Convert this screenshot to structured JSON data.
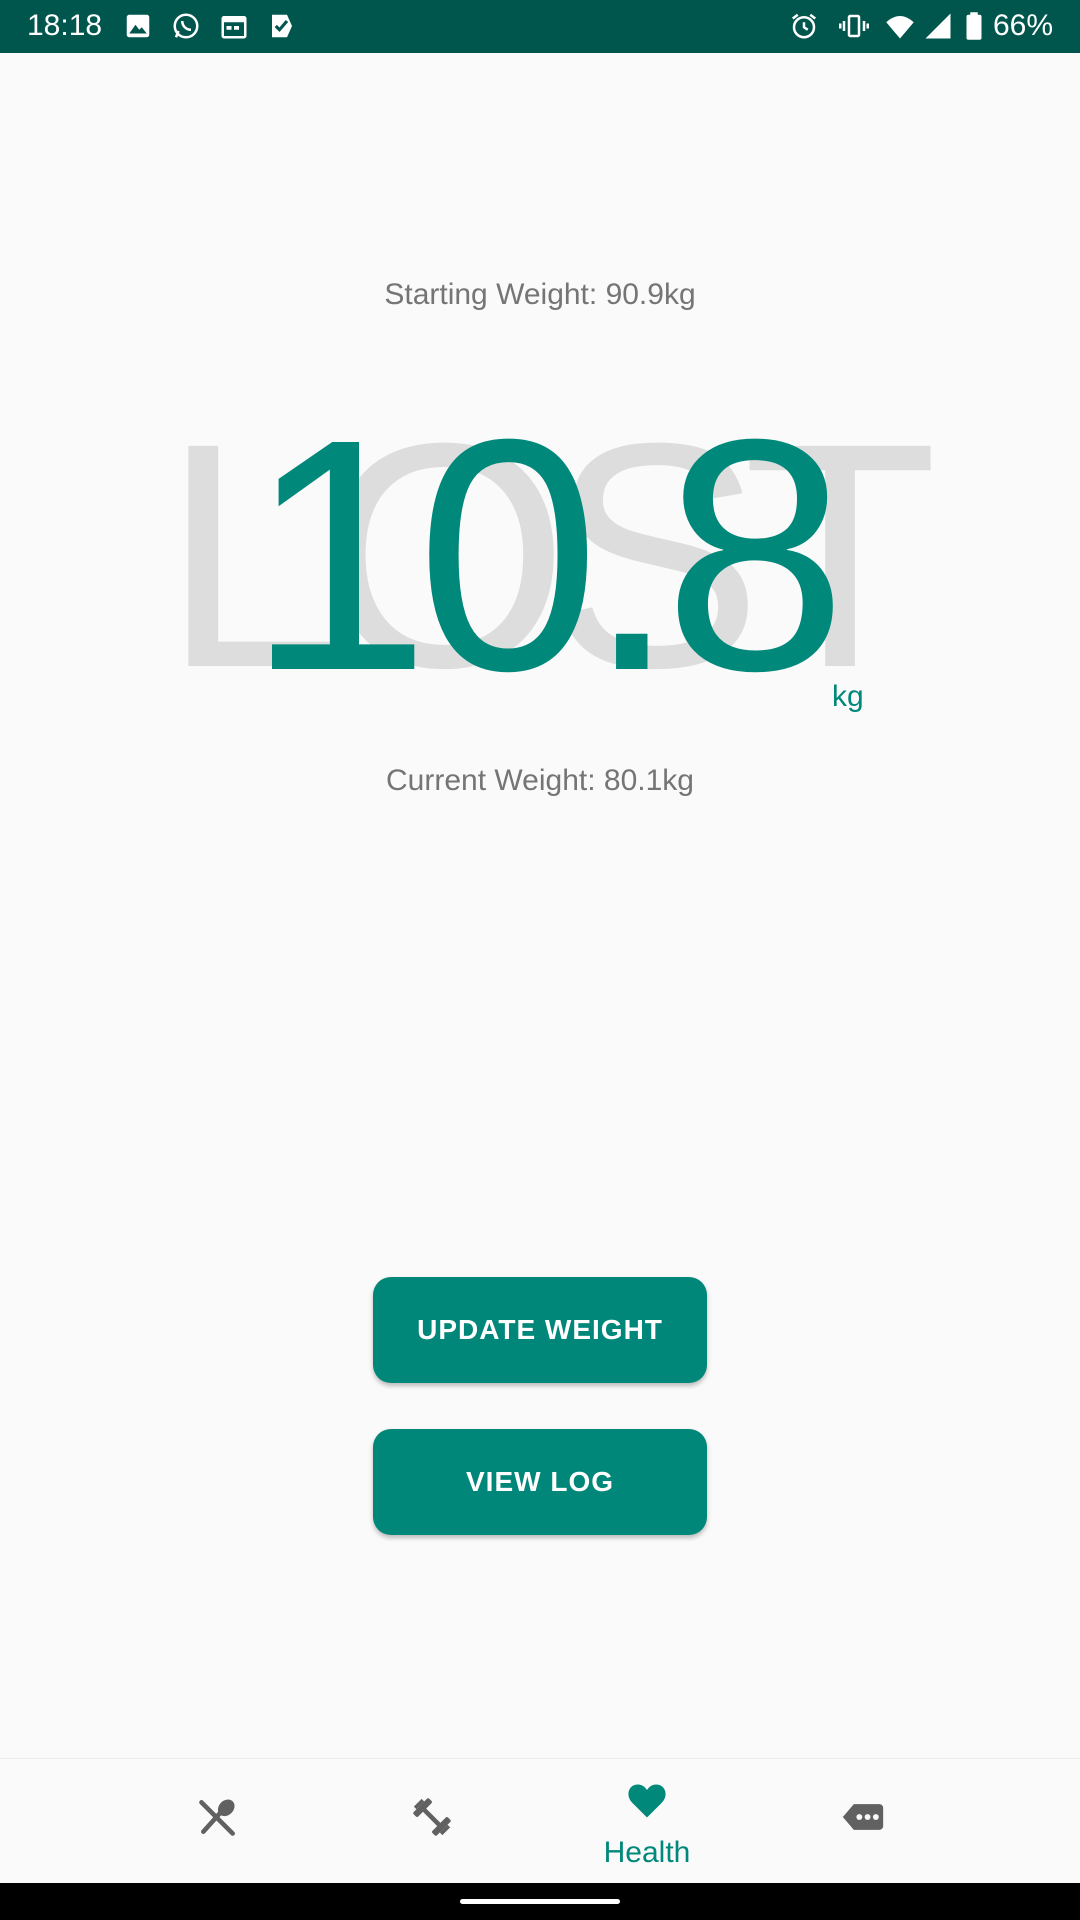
{
  "status_bar": {
    "time": "18:18",
    "battery_percent": "66%",
    "background_color": "#00564d",
    "icons": [
      "image-icon",
      "whatsapp-icon",
      "calendar-icon",
      "task-icon",
      "alarm-icon",
      "vibrate-icon",
      "wifi-icon",
      "signal-icon",
      "battery-icon"
    ]
  },
  "weight": {
    "starting_label": "Starting Weight: 90.9kg",
    "watermark": "LOST",
    "lost_value": "10.8",
    "unit": "kg",
    "current_label": "Current Weight: 80.1kg"
  },
  "buttons": {
    "update_weight": "UPDATE WEIGHT",
    "view_log": "VIEW LOG"
  },
  "bottom_nav": {
    "items": [
      {
        "icon": "food-utensils-icon",
        "label": ""
      },
      {
        "icon": "dumbbell-icon",
        "label": ""
      },
      {
        "icon": "heart-icon",
        "label": "Health",
        "active": true
      },
      {
        "icon": "more-tag-icon",
        "label": ""
      }
    ]
  },
  "colors": {
    "accent": "#00887a",
    "secondary_text": "#757575",
    "watermark": "#dddddd",
    "inactive_icon": "#616161"
  }
}
